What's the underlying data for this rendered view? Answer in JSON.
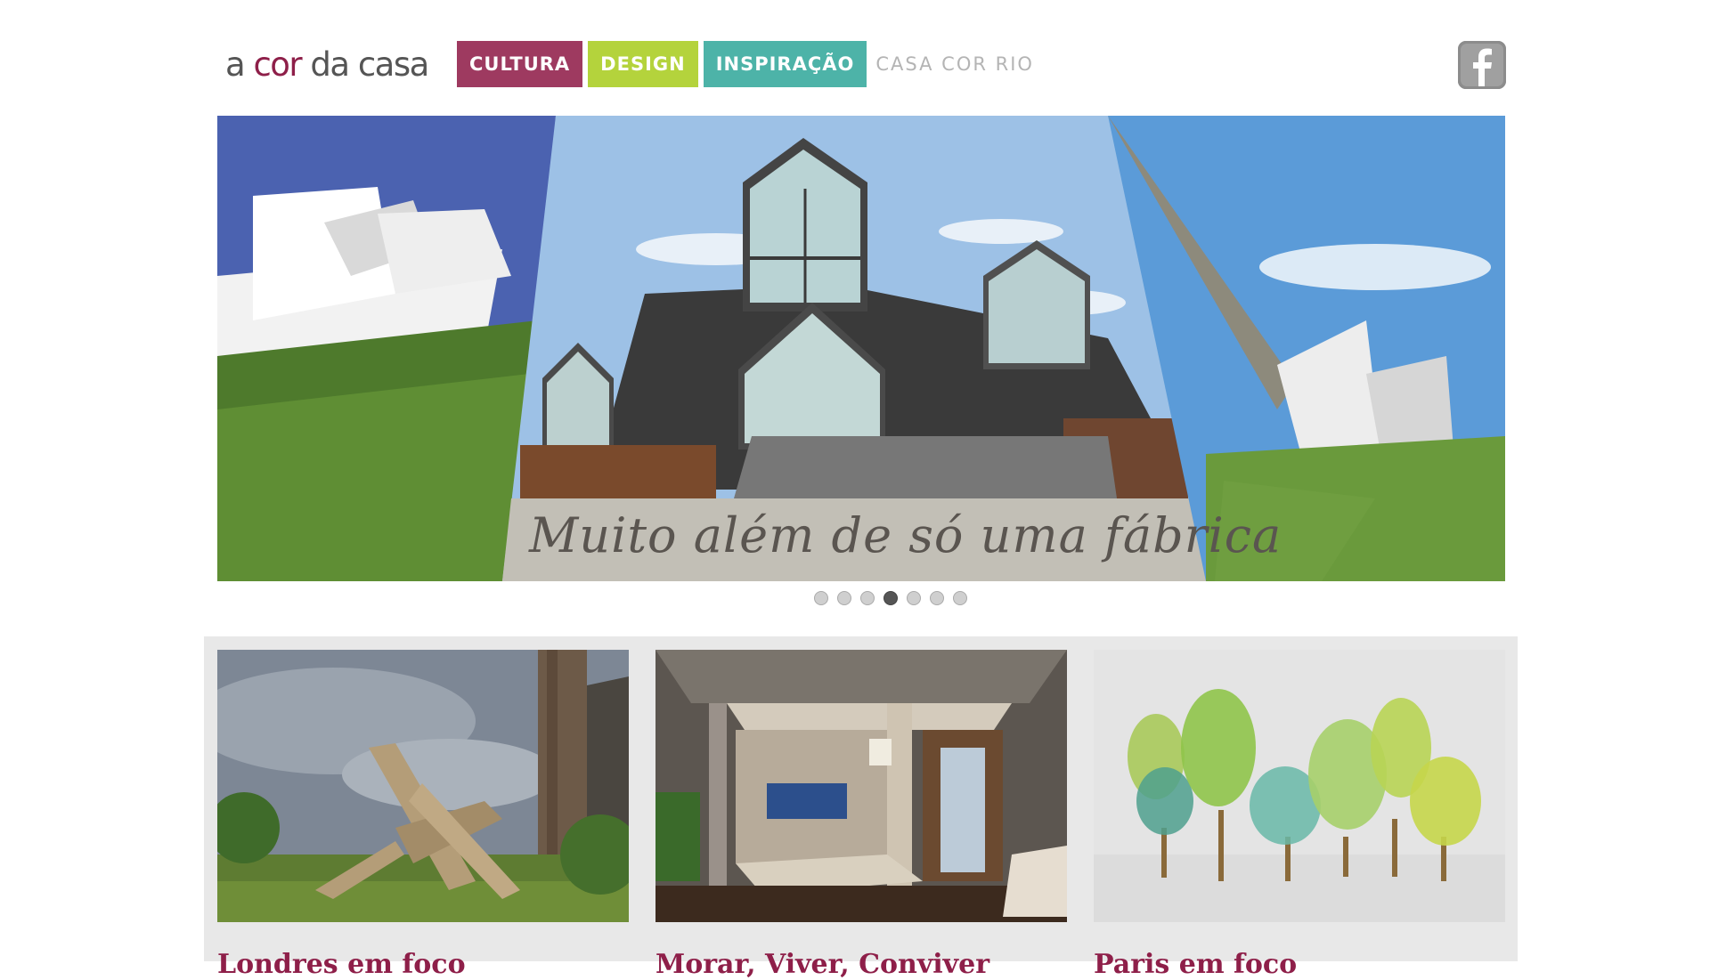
{
  "header": {
    "logo": {
      "prefix": "a ",
      "accent": "cor",
      "suffix": " da casa"
    },
    "nav": [
      {
        "label": "CULTURA",
        "color": "#9e3a60"
      },
      {
        "label": "DESIGN",
        "color": "#b4d33c"
      },
      {
        "label": "INSPIRAÇÃO",
        "color": "#4db3a8"
      },
      {
        "label": "CASA COR RIO",
        "color": ""
      }
    ],
    "social_icon": "facebook-icon"
  },
  "hero": {
    "caption": "Muito além de só uma fábrica",
    "slides_total": 7,
    "active_slide": 4
  },
  "cards": [
    {
      "title": "Londres em foco"
    },
    {
      "title": "Morar, Viver, Conviver"
    },
    {
      "title": "Paris em foco"
    }
  ],
  "colors": {
    "brand": "#8e1f49",
    "panel": "#e8e8e8"
  }
}
